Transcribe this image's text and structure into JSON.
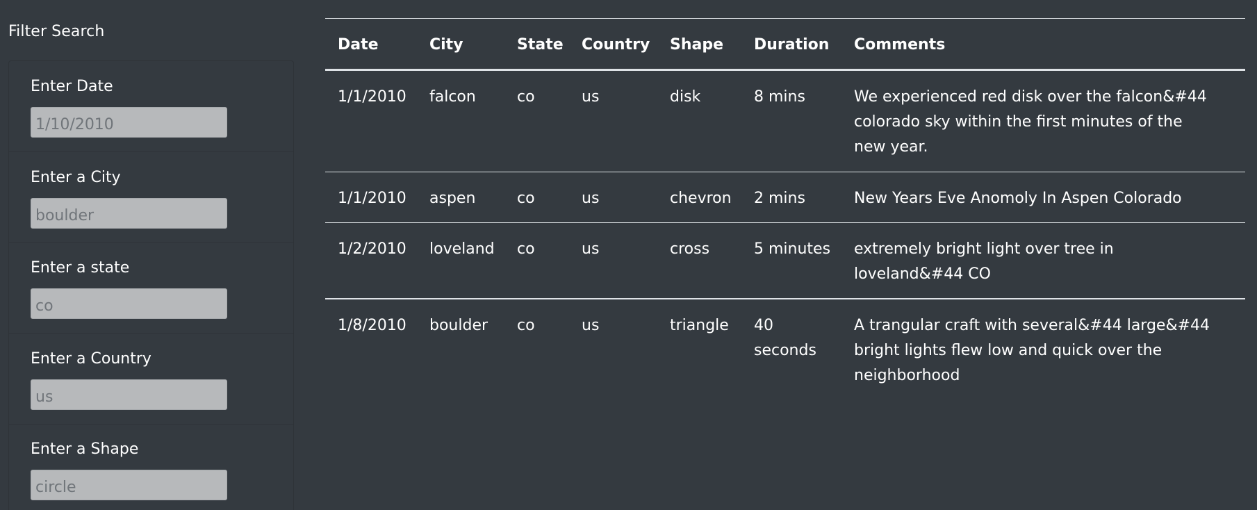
{
  "header": {
    "partial_heading": "·· ·······  ···· ·· ······· ·· ······ ··"
  },
  "filters": {
    "title": "Filter Search",
    "items": [
      {
        "label": "Enter Date",
        "placeholder": "1/10/2010"
      },
      {
        "label": "Enter a City",
        "placeholder": "boulder"
      },
      {
        "label": "Enter a state",
        "placeholder": "co"
      },
      {
        "label": "Enter a Country",
        "placeholder": "us"
      },
      {
        "label": "Enter a Shape",
        "placeholder": "circle"
      }
    ]
  },
  "table": {
    "columns": [
      "Date",
      "City",
      "State",
      "Country",
      "Shape",
      "Duration",
      "Comments"
    ],
    "rows": [
      {
        "date": "1/1/2010",
        "city": "falcon",
        "state": "co",
        "country": "us",
        "shape": "disk",
        "duration": "8 mins",
        "comments": "We experienced red disk over the falcon&#44 colorado sky within the first minutes of the new year."
      },
      {
        "date": "1/1/2010",
        "city": "aspen",
        "state": "co",
        "country": "us",
        "shape": "chevron",
        "duration": "2 mins",
        "comments": "New Years Eve Anomoly In Aspen Colorado"
      },
      {
        "date": "1/2/2010",
        "city": "loveland",
        "state": "co",
        "country": "us",
        "shape": "cross",
        "duration": "5 minutes",
        "comments": "extremely bright light over tree in loveland&#44 CO"
      },
      {
        "date": "1/8/2010",
        "city": "boulder",
        "state": "co",
        "country": "us",
        "shape": "triangle",
        "duration": "40 seconds",
        "comments": "A trangular craft with several&#44 large&#44 bright lights flew low and quick over the neighborhood"
      }
    ]
  }
}
